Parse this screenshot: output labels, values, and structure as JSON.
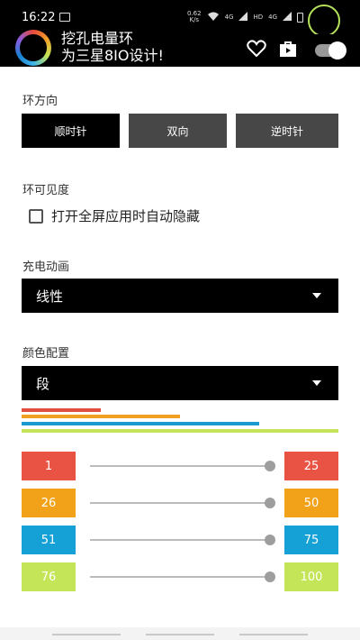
{
  "status": {
    "time": "16:22",
    "speed": "0.62\nK/s",
    "net1": "4G",
    "net2": "4G",
    "hd": "HD"
  },
  "app": {
    "title_line1": "挖孔电量环",
    "title_line2": "为三星8IO设计!"
  },
  "ring_direction": {
    "title": "环方向",
    "options": [
      "顺时针",
      "双向",
      "逆时针"
    ],
    "selected": "顺时针"
  },
  "ring_visibility": {
    "title": "环可见度",
    "checkbox_label": "打开全屏应用时自动隐藏",
    "checked": false
  },
  "charge_animation": {
    "title": "充电动画",
    "selected": "线性"
  },
  "color_config": {
    "title": "颜色配置",
    "selected": "段",
    "bars": [
      {
        "color": "#e05040",
        "fraction": 0.25
      },
      {
        "color": "#f0a020",
        "fraction": 0.5
      },
      {
        "color": "#1a9ad0",
        "fraction": 0.75
      },
      {
        "color": "#c5e35a",
        "fraction": 1.0
      }
    ],
    "ranges": [
      {
        "min": "1",
        "max": "25",
        "color": "#e85343",
        "fraction": 1.0
      },
      {
        "min": "26",
        "max": "50",
        "color": "#f2a218",
        "fraction": 1.0
      },
      {
        "min": "51",
        "max": "75",
        "color": "#16a1d6",
        "fraction": 1.0
      },
      {
        "min": "76",
        "max": "100",
        "color": "#c3e557",
        "fraction": 1.0
      }
    ]
  }
}
